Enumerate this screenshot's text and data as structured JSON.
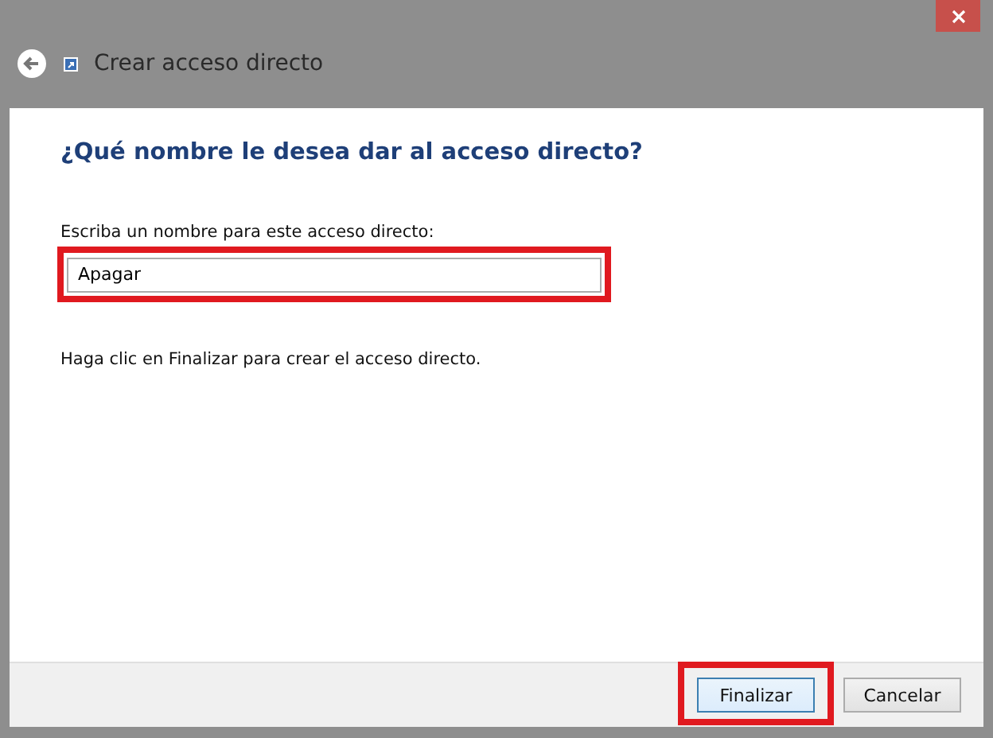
{
  "window": {
    "title": "Crear acceso directo"
  },
  "heading": "¿Qué nombre le desea dar al acceso directo?",
  "name_field": {
    "label": "Escriba un nombre para este acceso directo:",
    "value": "Apagar",
    "highlighted": true
  },
  "message": "Haga clic en Finalizar para crear el acceso directo.",
  "buttons": [
    {
      "label": "Finalizar",
      "kind": "default",
      "highlighted": true
    },
    {
      "label": "Cancelar",
      "kind": "normal",
      "highlighted": false
    }
  ]
}
